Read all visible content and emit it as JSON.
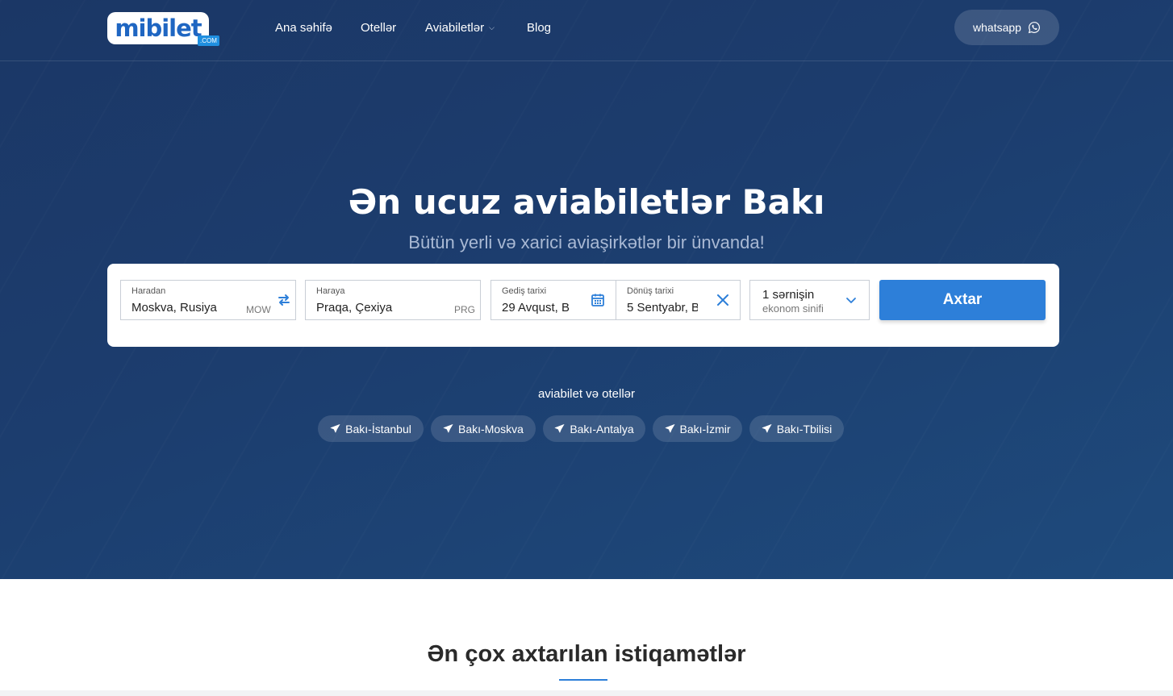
{
  "header": {
    "logo_text": "mibilet",
    "logo_tag": ".COM",
    "nav": [
      {
        "label": "Ana səhifə"
      },
      {
        "label": "Otellər"
      },
      {
        "label": "Aviabiletlər",
        "has_dropdown": true
      },
      {
        "label": "Blog"
      }
    ],
    "whatsapp_label": "whatsapp"
  },
  "hero": {
    "title": "Ən ucuz aviabiletlər Bakı",
    "subtitle": "Bütün yerli və xarici aviaşirkətlər bir ünvanda!"
  },
  "search": {
    "from": {
      "label": "Haradan",
      "value": "Moskva, Rusiya",
      "code": "MOW"
    },
    "to": {
      "label": "Haraya",
      "value": "Praqa, Çexiya",
      "code": "PRG"
    },
    "depart": {
      "label": "Gediş tarixi",
      "value": "29 Avqust, B"
    },
    "return": {
      "label": "Dönüş tarixi",
      "value": "5 Sentyabr, B"
    },
    "passengers": {
      "count": "1 sərnişin",
      "class": "ekonom sinifi"
    },
    "button_label": "Axtar"
  },
  "routes": {
    "label": "aviabilet və otellər",
    "items": [
      {
        "label": "Bakı-İstanbul"
      },
      {
        "label": "Bakı-Moskva"
      },
      {
        "label": "Bakı-Antalya"
      },
      {
        "label": "Bakı-İzmir"
      },
      {
        "label": "Bakı-Tbilisi"
      }
    ]
  },
  "section": {
    "title": "Ən çox axtarılan istiqamətlər"
  },
  "colors": {
    "brand_blue": "#2d7fd9",
    "hero_dark": "#1b3766",
    "hero_light": "#1e4a7c"
  }
}
